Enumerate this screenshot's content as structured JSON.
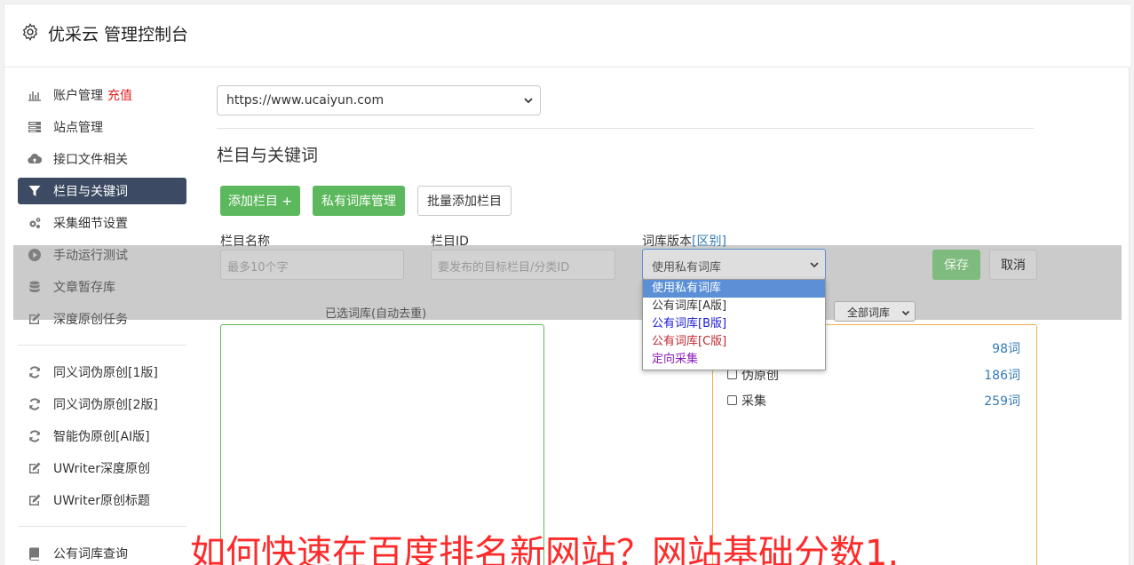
{
  "header": {
    "title": "优采云 管理控制台"
  },
  "sidebar": {
    "items": [
      {
        "label": "账户管理",
        "extra": "充值",
        "icon": "bar-chart-icon"
      },
      {
        "label": "站点管理",
        "icon": "server-icon"
      },
      {
        "label": "接口文件相关",
        "icon": "cloud-upload-icon"
      },
      {
        "label": "栏目与关键词",
        "icon": "filter-icon",
        "active": true
      },
      {
        "label": "采集细节设置",
        "icon": "cogs-icon"
      },
      {
        "label": "手动运行测试",
        "icon": "play-circle-icon"
      },
      {
        "label": "文章暂存库",
        "icon": "database-icon"
      },
      {
        "label": "深度原创任务",
        "icon": "edit-icon"
      }
    ],
    "items2": [
      {
        "label": "同义词伪原创[1版]",
        "icon": "refresh-icon"
      },
      {
        "label": "同义词伪原创[2版]",
        "icon": "refresh-icon"
      },
      {
        "label": "智能伪原创[AI版]",
        "icon": "refresh-icon"
      },
      {
        "label": "UWriter深度原创",
        "icon": "edit-icon"
      },
      {
        "label": "UWriter原创标题",
        "icon": "edit-icon"
      }
    ],
    "items3": [
      {
        "label": "公有词库查询",
        "icon": "book-icon"
      }
    ]
  },
  "main": {
    "site_select": {
      "value": "https://www.ucaiyun.com"
    },
    "section_title": "栏目与关键词",
    "buttons": {
      "add_column": "添加栏目 +",
      "private_lib": "私有词库管理",
      "batch_add": "批量添加栏目"
    },
    "form": {
      "column_name_label": "栏目名称",
      "column_name_placeholder": "最多10个字",
      "column_id_label": "栏目ID",
      "column_id_placeholder": "要发布的目标栏目/分类ID",
      "lib_version_label": "词库版本",
      "lib_version_link": "[区别]",
      "lib_version_value": "使用私有词库",
      "save": "保存",
      "cancel": "取消"
    },
    "dropdown_options": [
      {
        "label": "使用私有词库",
        "color": "#ffffff",
        "selected": true
      },
      {
        "label": "公有词库[A版]",
        "color": "#333333"
      },
      {
        "label": "公有词库[B版]",
        "color": "#1a1ad8"
      },
      {
        "label": "公有词库[C版]",
        "color": "#c0282f"
      },
      {
        "label": "定向采集",
        "color": "#8b1ab8"
      }
    ],
    "selected_lib_label": "已选词库(自动去重)",
    "filter_select": "全部词库",
    "libraries": [
      {
        "name": "",
        "count": "98词"
      },
      {
        "name": "伪原创",
        "count": "186词"
      },
      {
        "name": "采集",
        "count": "259词"
      }
    ]
  },
  "caption": "如何快速在百度排名新网站？网站基础分数1.",
  "colors": {
    "green": "#5cb85c",
    "active_nav": "#3c4a63",
    "link": "#337ab7",
    "recharge": "#e02020",
    "caption": "#ff2a2a"
  }
}
